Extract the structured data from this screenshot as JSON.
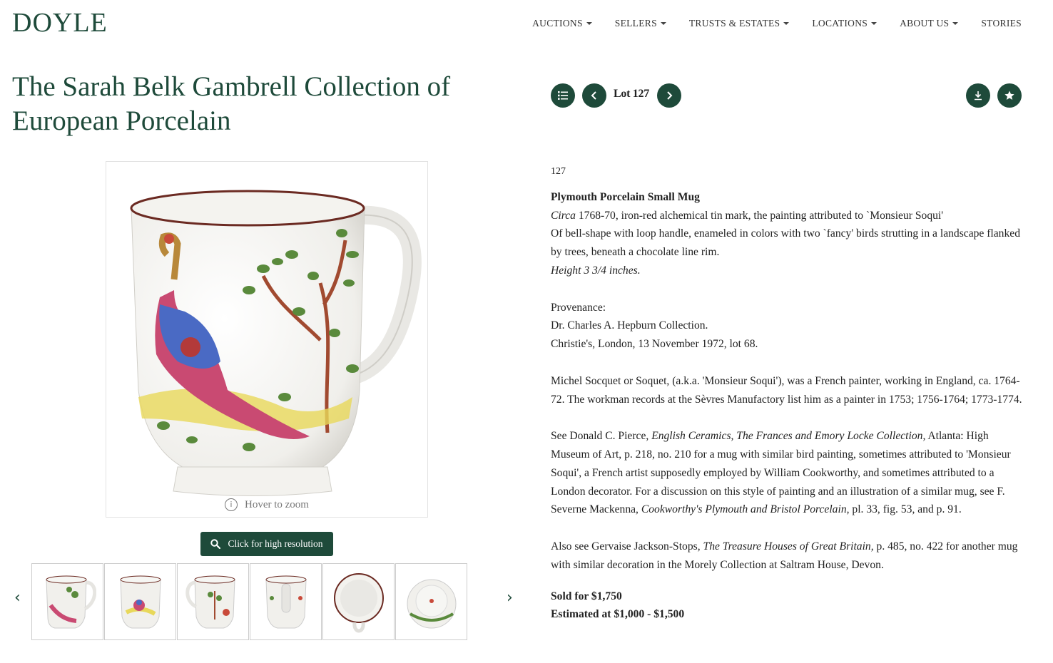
{
  "logo": "DOYLE",
  "nav": [
    "AUCTIONS",
    "SELLERS",
    "TRUSTS & ESTATES",
    "LOCATIONS",
    "ABOUT US",
    "STORIES"
  ],
  "title": "The Sarah Belk Gambrell Collection of European Porcelain",
  "image": {
    "hover_text": "Hover to zoom",
    "hires_button": "Click for high resolution"
  },
  "lot_nav": {
    "label": "Lot 127"
  },
  "lot": {
    "number": "127",
    "name": "Plymouth Porcelain Small Mug",
    "line1_italic": "Circa",
    "line1_rest": " 1768-70, iron-red alchemical tin mark, the painting attributed to `Monsieur Soqui'",
    "line2": "Of bell-shape with loop handle, enameled in colors with two `fancy' birds strutting in a landscape flanked by trees, beneath a chocolate line rim.",
    "height": "Height 3 3/4 inches.",
    "provenance_heading": "Provenance:",
    "provenance_1": "Dr. Charles A. Hepburn Collection.",
    "provenance_2": "Christie's, London, 13 November 1972, lot 68.",
    "note1": "Michel Socquet or Soquet, (a.k.a. 'Monsieur Soqui'), was a French painter, working in England, ca. 1764-72. The workman records at the Sèvres Manufactory list him as a painter in 1753; 1756-1764; 1773-1774.",
    "note2_a": "See Donald C. Pierce, ",
    "note2_b": "English Ceramics, The Frances and Emory Locke Collection,",
    "note2_c": " Atlanta: High Museum of Art, p. 218, no. 210 for a mug with similar bird painting, sometimes attributed to 'Monsieur Soqui', a French artist supposedly employed by William Cookworthy, and sometimes attributed to a London decorator. For a discussion on this style of painting and an illustration of a similar mug, see F. Severne Mackenna, ",
    "note2_d": "Cookworthy's Plymouth and Bristol Porcelain,",
    "note2_e": " pl. 33, fig. 53, and p. 91.",
    "note3_a": "Also see Gervaise Jackson-Stops, ",
    "note3_b": "The Treasure Houses of Great Britain,",
    "note3_c": " p. 485, no. 422 for another mug with similar decoration in the Morely Collection at Saltram House, Devon.",
    "sold": "Sold for $1,750",
    "estimate": "Estimated at $1,000 - $1,500"
  },
  "colors": {
    "brand": "#1e4a3a"
  }
}
